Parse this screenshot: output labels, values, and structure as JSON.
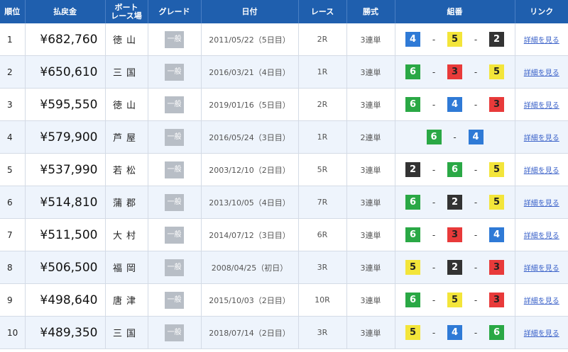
{
  "headers": [
    "順位",
    "払戻金",
    "ボート\nレース場",
    "グレード",
    "日付",
    "レース",
    "勝式",
    "組番",
    "リンク"
  ],
  "ball_colors": {
    "1": "#ffffff",
    "2": "#333333",
    "3": "#e83a3a",
    "4": "#2f7ad6",
    "5": "#f3e53a",
    "6": "#2aa845"
  },
  "rows": [
    {
      "rank": "1",
      "payout": "¥682,760",
      "venue": "徳山",
      "grade": "一般",
      "date": "2011/05/22（5日目）",
      "race": "2R",
      "bet": "3連単",
      "combo": [
        "4",
        "5",
        "2"
      ],
      "link": "詳細を見る"
    },
    {
      "rank": "2",
      "payout": "¥650,610",
      "venue": "三国",
      "grade": "一般",
      "date": "2016/03/21（4日目）",
      "race": "1R",
      "bet": "3連単",
      "combo": [
        "6",
        "3",
        "5"
      ],
      "link": "詳細を見る"
    },
    {
      "rank": "3",
      "payout": "¥595,550",
      "venue": "徳山",
      "grade": "一般",
      "date": "2019/01/16（5日目）",
      "race": "2R",
      "bet": "3連単",
      "combo": [
        "6",
        "4",
        "3"
      ],
      "link": "詳細を見る"
    },
    {
      "rank": "4",
      "payout": "¥579,900",
      "venue": "芦屋",
      "grade": "一般",
      "date": "2016/05/24（3日目）",
      "race": "1R",
      "bet": "2連単",
      "combo": [
        "6",
        "4"
      ],
      "link": "詳細を見る"
    },
    {
      "rank": "5",
      "payout": "¥537,990",
      "venue": "若松",
      "grade": "一般",
      "date": "2003/12/10（2日目）",
      "race": "5R",
      "bet": "3連単",
      "combo": [
        "2",
        "6",
        "5"
      ],
      "link": "詳細を見る"
    },
    {
      "rank": "6",
      "payout": "¥514,810",
      "venue": "蒲郡",
      "grade": "一般",
      "date": "2013/10/05（4日目）",
      "race": "7R",
      "bet": "3連単",
      "combo": [
        "6",
        "2",
        "5"
      ],
      "link": "詳細を見る"
    },
    {
      "rank": "7",
      "payout": "¥511,500",
      "venue": "大村",
      "grade": "一般",
      "date": "2014/07/12（3日目）",
      "race": "6R",
      "bet": "3連単",
      "combo": [
        "6",
        "3",
        "4"
      ],
      "link": "詳細を見る"
    },
    {
      "rank": "8",
      "payout": "¥506,500",
      "venue": "福岡",
      "grade": "一般",
      "date": "2008/04/25（初日）",
      "race": "3R",
      "bet": "3連単",
      "combo": [
        "5",
        "2",
        "3"
      ],
      "link": "詳細を見る"
    },
    {
      "rank": "9",
      "payout": "¥498,640",
      "venue": "唐津",
      "grade": "一般",
      "date": "2015/10/03（2日目）",
      "race": "10R",
      "bet": "3連単",
      "combo": [
        "6",
        "5",
        "3"
      ],
      "link": "詳細を見る"
    },
    {
      "rank": "10",
      "payout": "¥489,350",
      "venue": "三国",
      "grade": "一般",
      "date": "2018/07/14（2日目）",
      "race": "3R",
      "bet": "3連単",
      "combo": [
        "5",
        "4",
        "6"
      ],
      "link": "詳細を見る"
    }
  ]
}
